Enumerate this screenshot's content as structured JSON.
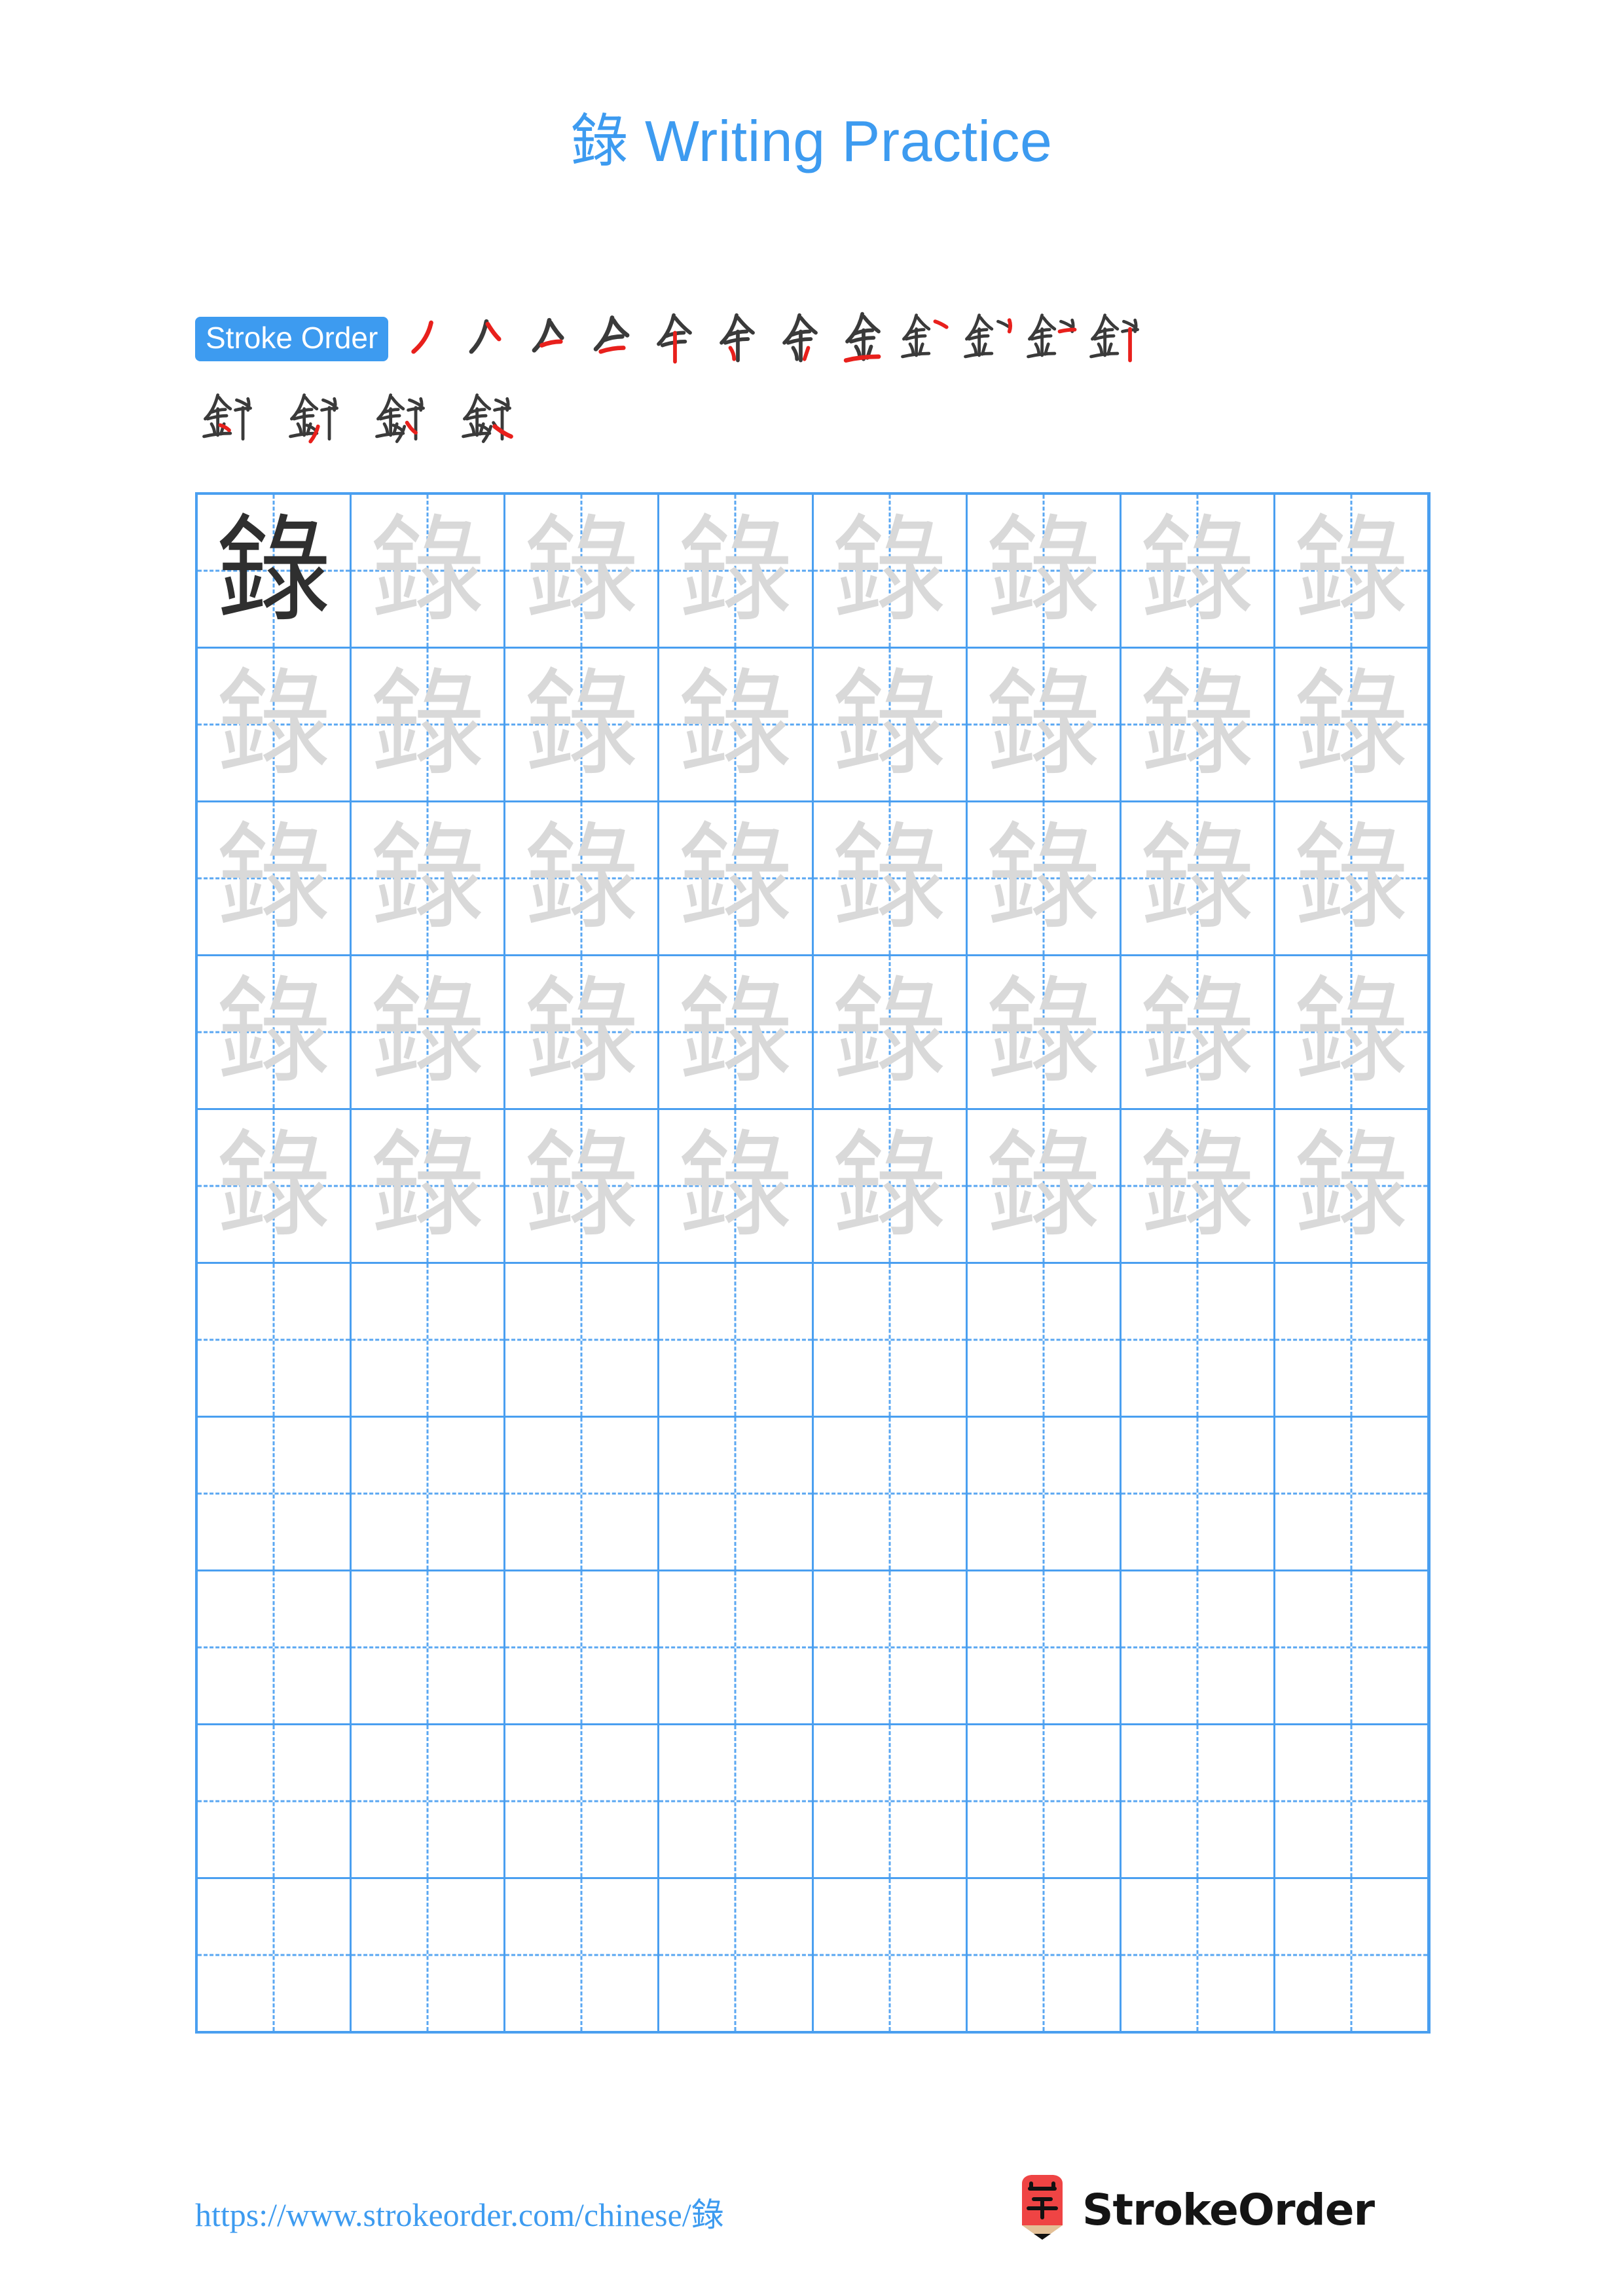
{
  "character": "錄",
  "title": "錄 Writing Practice",
  "colors": {
    "accent_blue": "#3d9bf0",
    "grid_blue": "#4a9ff0",
    "guide_blue": "#5aa7f2",
    "stroke_existing": "#3a3a3a",
    "stroke_new": "#e8201c",
    "trace_gray": "#d9d9d9",
    "solid_black": "#2f2f2f",
    "logo_red": "#ef4444",
    "logo_tan": "#e3c097"
  },
  "stroke_order": {
    "badge_label": "Stroke Order",
    "total_strokes": 16,
    "row1_count": 12,
    "row2_count": 4,
    "steps": [
      {
        "index": 1,
        "partial": "丿"
      },
      {
        "index": 2,
        "partial": "𠆢"
      },
      {
        "index": 3,
        "partial": "亽"
      },
      {
        "index": 4,
        "partial": "仐"
      },
      {
        "index": 5,
        "partial": "全"
      },
      {
        "index": 6,
        "partial": "仐"
      },
      {
        "index": 7,
        "partial": "余"
      },
      {
        "index": 8,
        "partial": "金"
      },
      {
        "index": 9,
        "partial": "釒"
      },
      {
        "index": 10,
        "partial": "釒"
      },
      {
        "index": 11,
        "partial": "釒"
      },
      {
        "index": 12,
        "partial": "釒"
      },
      {
        "index": 13,
        "partial": "釒"
      },
      {
        "index": 14,
        "partial": "釒"
      },
      {
        "index": 15,
        "partial": "錄"
      },
      {
        "index": 16,
        "partial": "錄"
      }
    ]
  },
  "practice_grid": {
    "columns": 8,
    "rows": 10,
    "filled_rows": 5,
    "blank_rows": 5,
    "cells": [
      [
        "solid",
        "trace",
        "trace",
        "trace",
        "trace",
        "trace",
        "trace",
        "trace"
      ],
      [
        "trace",
        "trace",
        "trace",
        "trace",
        "trace",
        "trace",
        "trace",
        "trace"
      ],
      [
        "trace",
        "trace",
        "trace",
        "trace",
        "trace",
        "trace",
        "trace",
        "trace"
      ],
      [
        "trace",
        "trace",
        "trace",
        "trace",
        "trace",
        "trace",
        "trace",
        "trace"
      ],
      [
        "trace",
        "trace",
        "trace",
        "trace",
        "trace",
        "trace",
        "trace",
        "trace"
      ],
      [
        "blank",
        "blank",
        "blank",
        "blank",
        "blank",
        "blank",
        "blank",
        "blank"
      ],
      [
        "blank",
        "blank",
        "blank",
        "blank",
        "blank",
        "blank",
        "blank",
        "blank"
      ],
      [
        "blank",
        "blank",
        "blank",
        "blank",
        "blank",
        "blank",
        "blank",
        "blank"
      ],
      [
        "blank",
        "blank",
        "blank",
        "blank",
        "blank",
        "blank",
        "blank",
        "blank"
      ],
      [
        "blank",
        "blank",
        "blank",
        "blank",
        "blank",
        "blank",
        "blank",
        "blank"
      ]
    ]
  },
  "footer": {
    "url": "https://www.strokeorder.com/chinese/錄",
    "brand_name": "StrokeOrder",
    "logo_char": "字"
  }
}
